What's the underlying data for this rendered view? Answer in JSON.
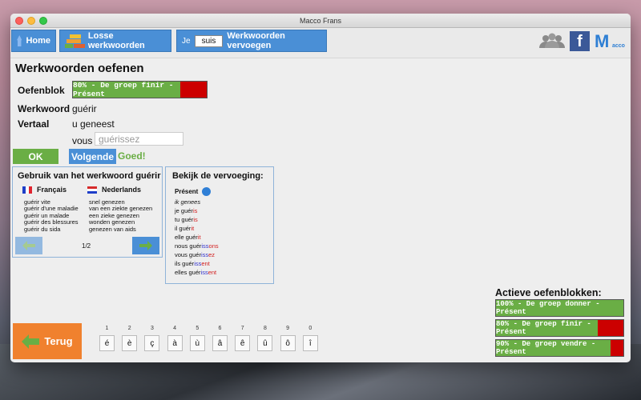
{
  "window": {
    "title": "Macco Frans"
  },
  "toolbar": {
    "home_label": "Home",
    "losse_label": "Losse werkwoorden",
    "je_label": "Je",
    "je_input_value": "suis",
    "vervoegen_label": "Werkwoorden vervoegen",
    "brand_logo_letter": "M",
    "brand_logo_text": "acco",
    "facebook_letter": "f"
  },
  "page": {
    "title": "Werkwoorden oefenen"
  },
  "form": {
    "oefenblok_label": "Oefenblok",
    "oefenblok_text": "80% - De groep finir - Présent",
    "oefenblok_progress": 0.8,
    "werkwoord_label": "Werkwoord",
    "werkwoord_value": "guérir",
    "vertaal_label": "Vertaal",
    "vertaal_value": "u geneest",
    "subject": "vous",
    "answer_placeholder": "guérissez",
    "ok_label": "OK",
    "volgende_label": "Volgende",
    "feedback": "Goed!"
  },
  "usage": {
    "title": "Gebruik van het werkwoord guérir",
    "col_fr": "Français",
    "col_nl": "Nederlands",
    "fr": [
      "guérir vite",
      "guérir d'une maladie",
      "guérir un malade",
      "guérir des blessures",
      "guérir du sida"
    ],
    "nl": [
      "snel genezen",
      "van een ziekte genezen",
      "een zieke genezen",
      "wonden genezen",
      "genezen van aids"
    ],
    "page": "1/2"
  },
  "conjugation": {
    "title": "Bekijk de vervoeging:",
    "tense": "Présent",
    "infinitive_nl": "ik genees",
    "rows": [
      {
        "stem": "je guér",
        "end": "is",
        "c": "red"
      },
      {
        "stem": "tu guér",
        "end": "is",
        "c": "red"
      },
      {
        "stem": "il guér",
        "end": "it",
        "c": "red"
      },
      {
        "stem": "elle guér",
        "end": "it",
        "c": "red"
      },
      {
        "stem": "nous guér",
        "mid": "iss",
        "end": "ons",
        "c": "red"
      },
      {
        "stem": "vous guér",
        "mid": "iss",
        "end": "ez",
        "c": "red"
      },
      {
        "stem": "ils guér",
        "mid": "iss",
        "end": "ent",
        "c": "red"
      },
      {
        "stem": "elles guér",
        "mid": "iss",
        "end": "ent",
        "c": "red"
      }
    ]
  },
  "keypad": {
    "numbers": [
      "1",
      "2",
      "3",
      "4",
      "5",
      "6",
      "7",
      "8",
      "9",
      "0"
    ],
    "chars": [
      "é",
      "è",
      "ç",
      "à",
      "ù",
      "â",
      "ê",
      "û",
      "ô",
      "î"
    ]
  },
  "back": {
    "label": "Terug"
  },
  "active": {
    "title": "Actieve oefenblokken:",
    "items": [
      {
        "text": "100% - De groep donner - Présent",
        "progress": 1.0
      },
      {
        "text": "80% - De groep finir - Présent",
        "progress": 0.8
      },
      {
        "text": "90% - De groep vendre - Présent",
        "progress": 0.9
      }
    ]
  },
  "colors": {
    "accent_blue": "#4a8fd6",
    "green": "#6aae45",
    "red": "#cc0000",
    "orange": "#f0812e"
  }
}
